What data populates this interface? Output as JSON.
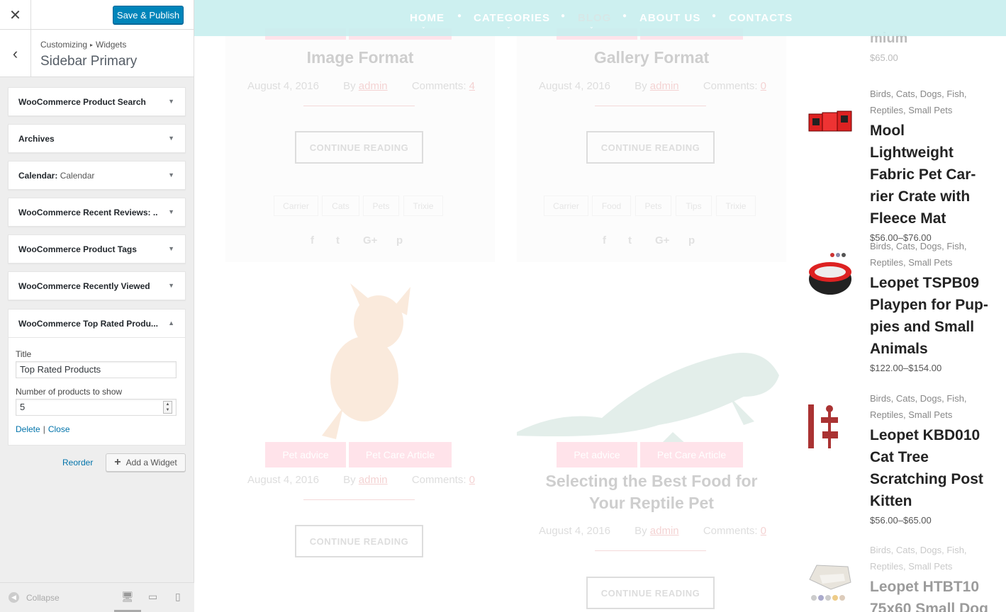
{
  "customizer": {
    "close_icon": "✕",
    "save_label": "Save & Publish",
    "breadcrumb_root": "Customizing",
    "breadcrumb_sep": "▸",
    "breadcrumb_section": "Widgets",
    "section_title": "Sidebar Primary",
    "back_icon": "‹",
    "widgets": [
      {
        "label": "WooCommerce Product Search",
        "sub": ""
      },
      {
        "label": "Archives",
        "sub": ""
      },
      {
        "label": "Calendar:",
        "sub": " Calendar"
      },
      {
        "label": "WooCommerce Recent Reviews: ...",
        "sub": ""
      },
      {
        "label": "WooCommerce Product Tags",
        "sub": ""
      },
      {
        "label": "WooCommerce Recently Viewed",
        "sub": ""
      }
    ],
    "open_widget": {
      "label": "WooCommerce Top Rated Produ...",
      "title_label": "Title",
      "title_value": "Top Rated Products",
      "count_label": "Number of products to show",
      "count_value": "5",
      "delete_label": "Delete",
      "close_label": "Close"
    },
    "reorder_label": "Reorder",
    "add_widget_label": "Add a Widget",
    "collapse_label": "Collapse"
  },
  "preview": {
    "nav": [
      "HOME",
      "CATEGORIES",
      "BLOG",
      "ABOUT US",
      "CONTACTS"
    ],
    "nav_active": "BLOG",
    "posts": [
      {
        "title": "Image Format",
        "date": "August 4, 2016",
        "by": "By",
        "author": "admin",
        "comments_label": "Comments:",
        "comments": "4",
        "tags": [
          "Carrier",
          "Cats",
          "Pets",
          "Trixie"
        ]
      },
      {
        "title": "Gallery Format",
        "date": "August 4, 2016",
        "by": "By",
        "author": "admin",
        "comments_label": "Comments:",
        "comments": "0",
        "tags": [
          "Carrier",
          "Food",
          "Pets",
          "Tips",
          "Trixie"
        ]
      },
      {
        "title": "",
        "date": "August 4, 2016",
        "by": "By",
        "author": "admin",
        "comments_label": "Comments:",
        "comments": "0",
        "categories": [
          "Pet advice",
          "Pet Care Article"
        ]
      },
      {
        "title_line1": "Selecting the Best Food for",
        "title_line2": "Your Reptile Pet",
        "date": "August 4, 2016",
        "by": "By",
        "author": "admin",
        "comments_label": "Comments:",
        "comments": "0",
        "categories": [
          "Pet advice",
          "Pet Care Article"
        ]
      }
    ],
    "continue_label": "CONTINUE READING",
    "products_top": {
      "name_tail": "mium",
      "price": "$65.00"
    },
    "products": [
      {
        "cats_line1": "Birds, Cats, Dogs, Fish,",
        "cats_line2": "Reptiles, Small Pets",
        "name": [
          "Mool Lightweight",
          "Fabric Pet Car-",
          "rier Crate with",
          "Fleece Mat"
        ],
        "price": "$56.00–$76.00"
      },
      {
        "cats_line1": "Birds, Cats, Dogs, Fish,",
        "cats_line2": "Reptiles, Small Pets",
        "name": [
          "Leopet TSPB09",
          "Playpen for Pup-",
          "pies and Small",
          "Animals"
        ],
        "price": "$122.00–$154.00"
      },
      {
        "cats_line1": "Birds, Cats, Dogs, Fish,",
        "cats_line2": "Reptiles, Small Pets",
        "name": [
          "Leopet KBD010",
          "Cat Tree",
          "Scratching Post",
          "Kitten"
        ],
        "price": "$56.00–$65.00"
      },
      {
        "cats_line1": "Birds, Cats, Dogs, Fish,",
        "cats_line2": "Reptiles, Small Pets",
        "name": [
          "Leopet HTBT10",
          "75x60 Small Dog"
        ],
        "price": ""
      }
    ]
  }
}
